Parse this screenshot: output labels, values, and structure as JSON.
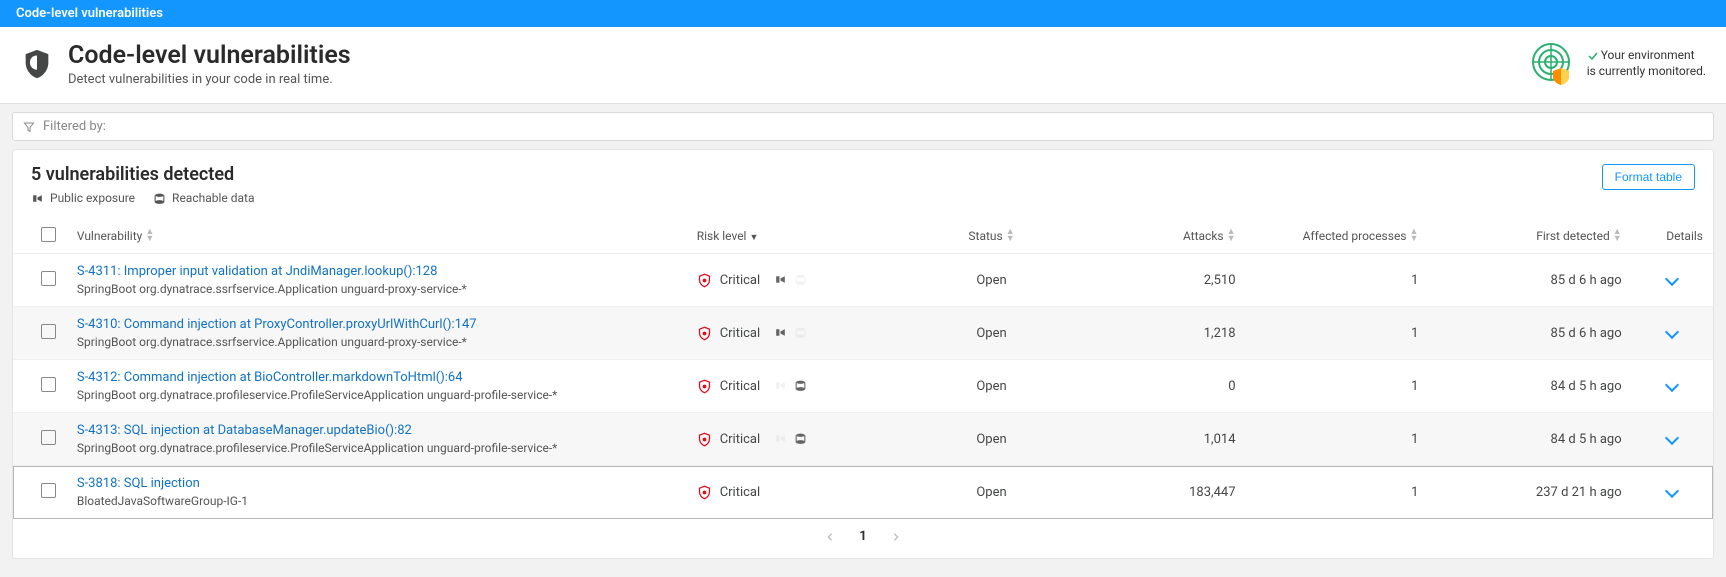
{
  "topbar": {
    "title": "Code-level vulnerabilities"
  },
  "header": {
    "title": "Code-level vulnerabilities",
    "subtitle": "Detect vulnerabilities in your code in real time.",
    "env_status_line1": "Your environment",
    "env_status_line2": "is currently monitored."
  },
  "filter": {
    "label": "Filtered by:"
  },
  "summary": {
    "title": "5 vulnerabilities detected",
    "legend_public": "Public exposure",
    "legend_reachable": "Reachable data",
    "format_btn": "Format table"
  },
  "columns": {
    "vuln": "Vulnerability",
    "risk": "Risk level",
    "status": "Status",
    "attacks": "Attacks",
    "processes": "Affected processes",
    "first": "First detected",
    "details": "Details"
  },
  "rows": [
    {
      "title": "S-4311: Improper input validation at JndiManager.lookup():128",
      "sub": "SpringBoot org.dynatrace.ssrfservice.Application unguard-proxy-service-*",
      "risk": "Critical",
      "status": "Open",
      "attacks": "2,510",
      "processes": "1",
      "first": "85 d 6 h ago",
      "public_exposure": true,
      "reachable_data": false
    },
    {
      "title": "S-4310: Command injection at ProxyController.proxyUrlWithCurl():147",
      "sub": "SpringBoot org.dynatrace.ssrfservice.Application unguard-proxy-service-*",
      "risk": "Critical",
      "status": "Open",
      "attacks": "1,218",
      "processes": "1",
      "first": "85 d 6 h ago",
      "public_exposure": true,
      "reachable_data": false
    },
    {
      "title": "S-4312: Command injection at BioController.markdownToHtml():64",
      "sub": "SpringBoot org.dynatrace.profileservice.ProfileServiceApplication unguard-profile-service-*",
      "risk": "Critical",
      "status": "Open",
      "attacks": "0",
      "processes": "1",
      "first": "84 d 5 h ago",
      "public_exposure": false,
      "reachable_data": true
    },
    {
      "title": "S-4313: SQL injection at DatabaseManager.updateBio():82",
      "sub": "SpringBoot org.dynatrace.profileservice.ProfileServiceApplication unguard-profile-service-*",
      "risk": "Critical",
      "status": "Open",
      "attacks": "1,014",
      "processes": "1",
      "first": "84 d 5 h ago",
      "public_exposure": false,
      "reachable_data": true
    },
    {
      "title": "S-3818: SQL injection",
      "sub": "BloatedJavaSoftwareGroup-IG-1",
      "risk": "Critical",
      "status": "Open",
      "attacks": "183,447",
      "processes": "1",
      "first": "237 d 21 h ago",
      "public_exposure": null,
      "reachable_data": null
    }
  ],
  "pager": {
    "current": "1"
  },
  "colors": {
    "primary": "#1496ff",
    "link": "#1172c4",
    "critical": "#e30b1c",
    "green": "#2ab06f",
    "orange": "#fd8c00"
  }
}
